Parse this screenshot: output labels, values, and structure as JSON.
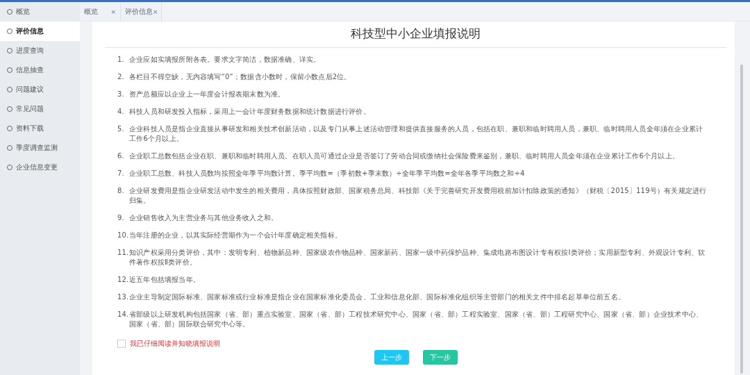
{
  "sidebar": {
    "items": [
      {
        "label": "概览",
        "selected": false
      },
      {
        "label": "评价信息",
        "selected": true
      },
      {
        "label": "进度查询",
        "selected": false
      },
      {
        "label": "信息抽查",
        "selected": false
      },
      {
        "label": "问题建议",
        "selected": false
      },
      {
        "label": "常见问题",
        "selected": false
      },
      {
        "label": "资料下载",
        "selected": false
      },
      {
        "label": "季度调查监测",
        "selected": false
      },
      {
        "label": "企业信息变更",
        "selected": false
      }
    ]
  },
  "tabs": [
    {
      "label": "概览",
      "close": "×"
    },
    {
      "label": "评价信息",
      "close": "×"
    }
  ],
  "document": {
    "title": "科技型中小企业填报说明",
    "items": [
      {
        "number": "1.",
        "text": "企业应如实填报所附各表。要求文字简洁，数据准确、详实。"
      },
      {
        "number": "2.",
        "text": "各栏目不得空缺，无内容填写“0”；数据含小数时，保留小数点后2位。"
      },
      {
        "number": "3.",
        "text": "资产总额应以企业上一年度会计报表期末数为准。"
      },
      {
        "number": "4.",
        "text": "科技人员和研发投入指标，采用上一会计年度财务数据和统计数据进行评价。"
      },
      {
        "number": "5.",
        "text": "企业科技人员是指企业直接从事研发和相关技术创新活动，以及专门从事上述活动管理和提供直接服务的人员，包括在职、兼职和临时聘用人员，兼职、临时聘用人员全年须在企业累计工作6个月以上。"
      },
      {
        "number": "6.",
        "text": "企业职工总数包括企业在职、兼职和临时聘用人员。在职人员可通过企业是否签订了劳动合同或缴纳社会保险费来鉴别，兼职、临时聘用人员全年须在企业累计工作6个月以上。"
      },
      {
        "number": "7.",
        "text": "企业职工总数、科技人员数均按照全年季平均数计算。季平均数=（季初数+季末数）÷全年季平均数=全年各季平均数之和÷4"
      },
      {
        "number": "8.",
        "text": "企业研发费用是指企业研发活动中发生的相关费用，具体按照财政部、国家税务总局、科技部《关于完善研究开发费用税前加计扣除政策的通知》（财税〔2015〕119号）有关规定进行归集。"
      },
      {
        "number": "9.",
        "text": "企业销售收入为主营业务与其他业务收入之和。"
      },
      {
        "number": "10.",
        "text": "当年注册的企业，以其实际经营期作为一个会计年度确定相关指标。"
      },
      {
        "number": "11.",
        "text": "知识产权采用分类评价，其中：发明专利、植物新品种、国家级农作物品种、国家新药、国家一级中药保护品种、集成电路布图设计专有权按Ⅰ类评价；实用新型专利、外观设计专利、软件著作权按Ⅱ类评价。"
      },
      {
        "number": "12.",
        "text": "近五年包括填报当年。"
      },
      {
        "number": "13.",
        "text": "企业主导制定国际标准、国家标准或行业标准是指企业在国家标准化委员会、工业和信息化部、国际标准化组织等主管部门的相关文件中排名起草单位前五名。"
      },
      {
        "number": "14.",
        "text": "省部级以上研发机构包括国家（省、部）重点实验室、国家（省、部）工程技术研究中心、国家（省、部）工程实验室、国家（省、部）工程研究中心、国家（省、部）企业技术中心、国家（省、部）国际联合研究中心等。"
      }
    ],
    "agreement": {
      "label": "我已仔细阅读并知晓填报说明",
      "checked": false
    },
    "buttons": [
      {
        "label": "上一步",
        "kind": "prev"
      },
      {
        "label": "下一步",
        "kind": "next"
      }
    ]
  }
}
